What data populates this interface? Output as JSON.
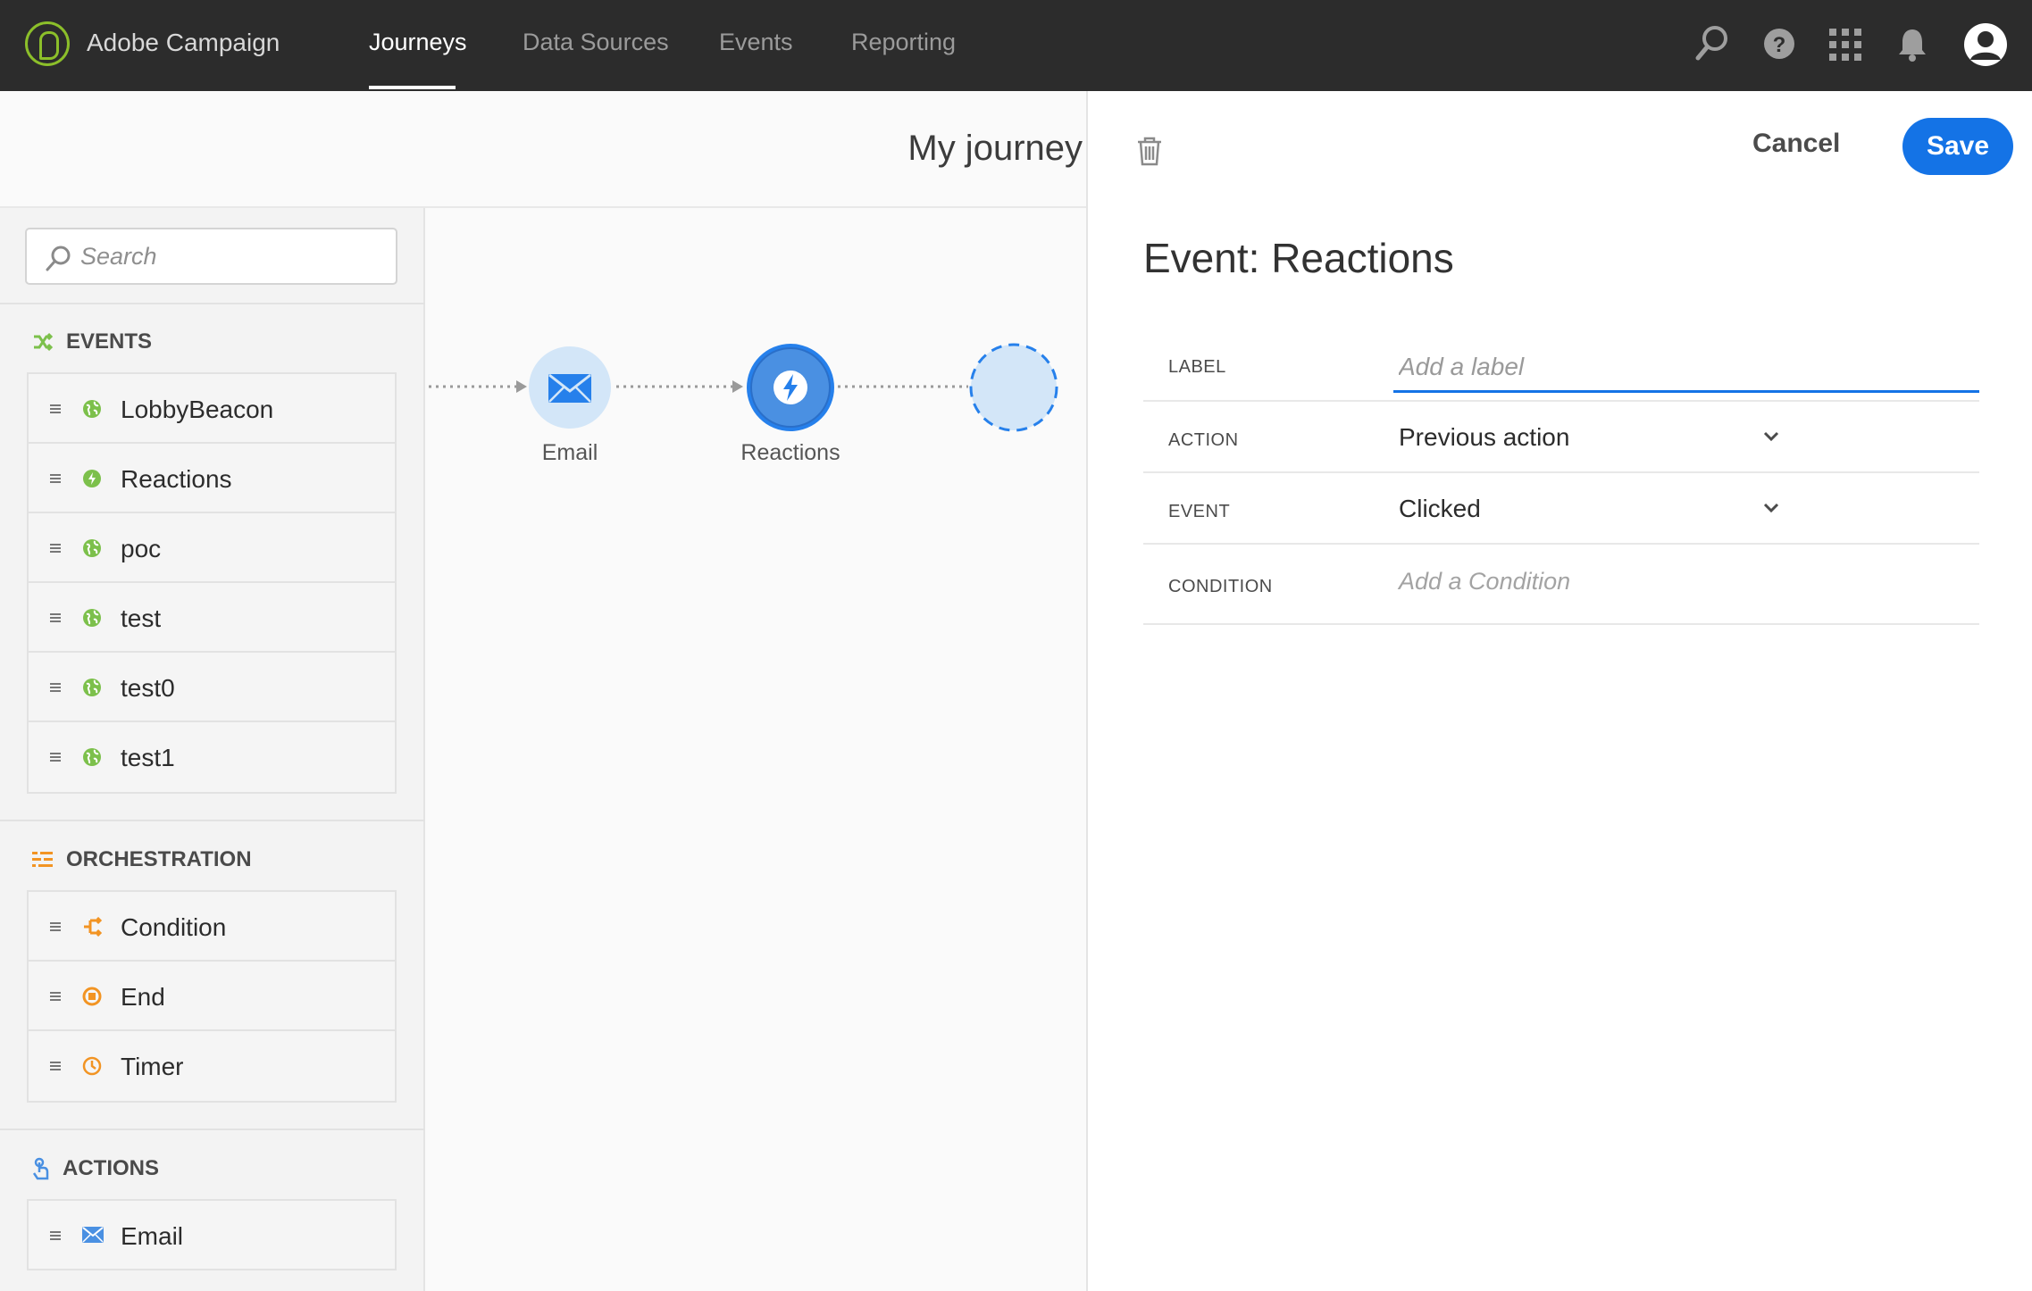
{
  "app": {
    "brand": "Adobe Campaign"
  },
  "nav": {
    "items": [
      "Journeys",
      "Data Sources",
      "Events",
      "Reporting"
    ],
    "active": "Journeys"
  },
  "journey": {
    "title": "My journey"
  },
  "palette": {
    "search": {
      "placeholder": "Search"
    },
    "sections": {
      "events": {
        "title": "EVENTS",
        "items": [
          "LobbyBeacon",
          "Reactions",
          "poc",
          "test",
          "test0",
          "test1"
        ]
      },
      "orchestration": {
        "title": "ORCHESTRATION",
        "items": [
          "Condition",
          "End",
          "Timer"
        ]
      },
      "actions": {
        "title": "ACTIONS",
        "items": [
          "Email"
        ]
      }
    }
  },
  "canvas": {
    "nodes": [
      "Email",
      "Reactions"
    ]
  },
  "panel": {
    "title": "Event: Reactions",
    "cancel_label": "Cancel",
    "save_label": "Save",
    "fields": {
      "label": {
        "name": "LABEL",
        "placeholder": "Add a label"
      },
      "action": {
        "name": "ACTION",
        "value": "Previous action"
      },
      "event": {
        "name": "EVENT",
        "value": "Clicked"
      },
      "condition": {
        "name": "CONDITION",
        "placeholder": "Add a Condition"
      }
    }
  },
  "colors": {
    "accent": "#1473e6",
    "event_green": "#7cc04b",
    "orchestration_orange": "#f29423",
    "topbar": "#2c2c2c"
  }
}
